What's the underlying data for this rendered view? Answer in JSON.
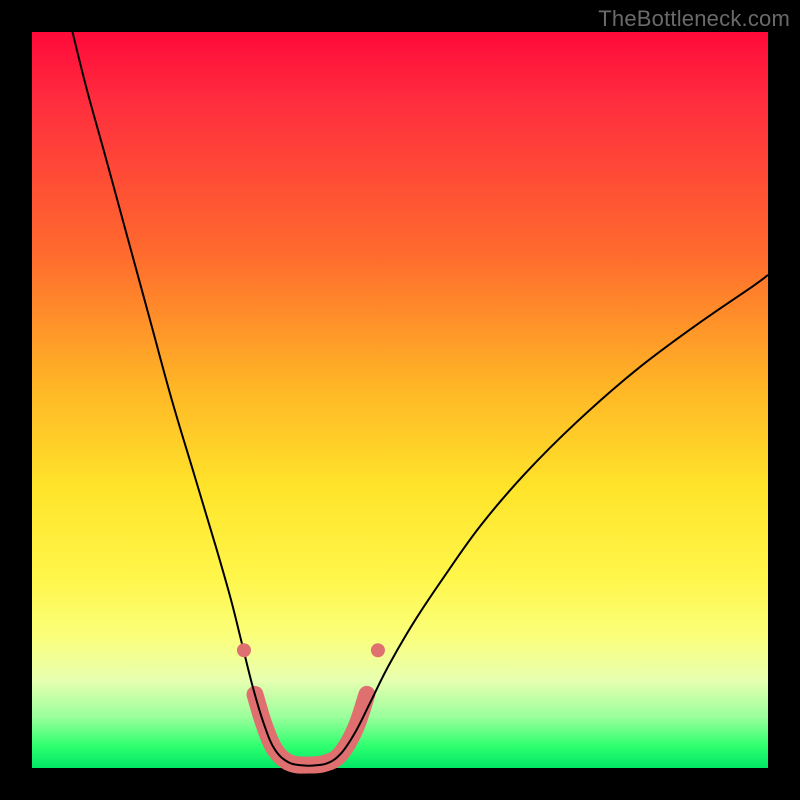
{
  "watermark": "TheBottleneck.com",
  "chart_data": {
    "type": "line",
    "title": "",
    "xlabel": "",
    "ylabel": "",
    "xlim": [
      0,
      100
    ],
    "ylim": [
      0,
      100
    ],
    "gradient_stops": [
      {
        "pos": 0,
        "color": "#ff0a3a"
      },
      {
        "pos": 10,
        "color": "#ff2f3e"
      },
      {
        "pos": 30,
        "color": "#ff6a2d"
      },
      {
        "pos": 48,
        "color": "#ffb526"
      },
      {
        "pos": 62,
        "color": "#ffe42a"
      },
      {
        "pos": 74,
        "color": "#fff64a"
      },
      {
        "pos": 82,
        "color": "#fbff7a"
      },
      {
        "pos": 88,
        "color": "#e8ffb0"
      },
      {
        "pos": 93,
        "color": "#9cff9c"
      },
      {
        "pos": 97,
        "color": "#2fff70"
      },
      {
        "pos": 100,
        "color": "#00e765"
      }
    ],
    "series": [
      {
        "name": "curve_left",
        "stroke": "#000000",
        "points": [
          {
            "x": 5.5,
            "y": 100.0
          },
          {
            "x": 7.5,
            "y": 92.0
          },
          {
            "x": 10.0,
            "y": 83.0
          },
          {
            "x": 13.0,
            "y": 72.0
          },
          {
            "x": 16.0,
            "y": 61.0
          },
          {
            "x": 19.0,
            "y": 50.0
          },
          {
            "x": 22.0,
            "y": 40.0
          },
          {
            "x": 25.0,
            "y": 30.0
          },
          {
            "x": 27.0,
            "y": 23.0
          },
          {
            "x": 28.5,
            "y": 17.0
          },
          {
            "x": 30.0,
            "y": 11.0
          },
          {
            "x": 31.5,
            "y": 6.0
          },
          {
            "x": 33.0,
            "y": 2.5
          },
          {
            "x": 35.0,
            "y": 0.7
          },
          {
            "x": 37.5,
            "y": 0.3
          }
        ]
      },
      {
        "name": "curve_right",
        "stroke": "#000000",
        "points": [
          {
            "x": 37.5,
            "y": 0.3
          },
          {
            "x": 40.0,
            "y": 0.6
          },
          {
            "x": 42.0,
            "y": 2.0
          },
          {
            "x": 44.0,
            "y": 5.0
          },
          {
            "x": 46.0,
            "y": 9.0
          },
          {
            "x": 48.5,
            "y": 14.0
          },
          {
            "x": 52.0,
            "y": 20.0
          },
          {
            "x": 56.0,
            "y": 26.0
          },
          {
            "x": 61.0,
            "y": 33.0
          },
          {
            "x": 67.0,
            "y": 40.0
          },
          {
            "x": 74.0,
            "y": 47.0
          },
          {
            "x": 82.0,
            "y": 54.0
          },
          {
            "x": 90.0,
            "y": 60.0
          },
          {
            "x": 98.0,
            "y": 65.5
          },
          {
            "x": 100.0,
            "y": 67.0
          }
        ]
      },
      {
        "name": "highlight_band",
        "stroke": "#e07070",
        "stroke_width_px": 17,
        "points": [
          {
            "x": 30.3,
            "y": 10.0
          },
          {
            "x": 31.5,
            "y": 6.0
          },
          {
            "x": 33.0,
            "y": 2.5
          },
          {
            "x": 35.0,
            "y": 0.7
          },
          {
            "x": 37.5,
            "y": 0.4
          },
          {
            "x": 40.0,
            "y": 0.7
          },
          {
            "x": 42.0,
            "y": 2.0
          },
          {
            "x": 44.0,
            "y": 5.5
          },
          {
            "x": 45.5,
            "y": 10.0
          }
        ]
      }
    ],
    "markers_outside_band": [
      {
        "x": 28.8,
        "y": 16.0
      },
      {
        "x": 47.0,
        "y": 16.0
      }
    ],
    "marker_color": "#e07070",
    "marker_radius_px": 7
  }
}
